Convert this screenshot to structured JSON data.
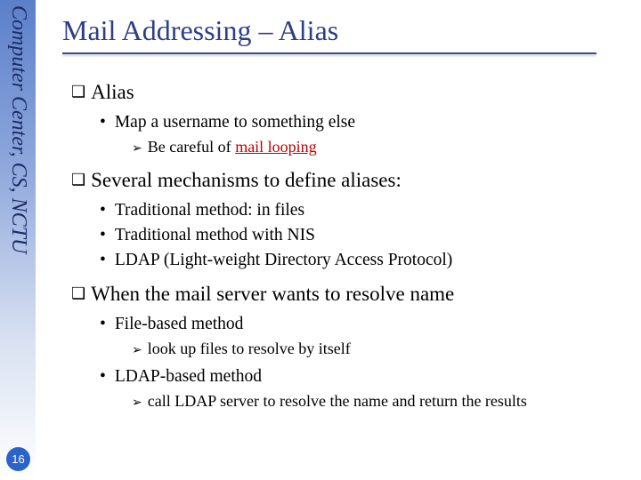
{
  "sidebar": {
    "label": "Computer Center, CS, NCTU"
  },
  "page_number": "16",
  "title": "Mail Addressing – Alias",
  "sections": {
    "s1": {
      "heading": "Alias",
      "b1": "Map a username to something else",
      "s1_1_prefix": "Be careful of ",
      "s1_1_danger": "mail looping"
    },
    "s2": {
      "heading": "Several mechanisms to define aliases:",
      "b1": "Traditional method: in files",
      "b2": "Traditional method with NIS",
      "b3": "LDAP (Light-weight Directory Access Protocol)"
    },
    "s3": {
      "heading": "When the mail server wants to resolve name",
      "b1": "File-based method",
      "s3_1_1": "look up files to resolve by itself",
      "b2": "LDAP-based method",
      "s3_2_1": "call LDAP server to resolve the name and return the results"
    }
  }
}
